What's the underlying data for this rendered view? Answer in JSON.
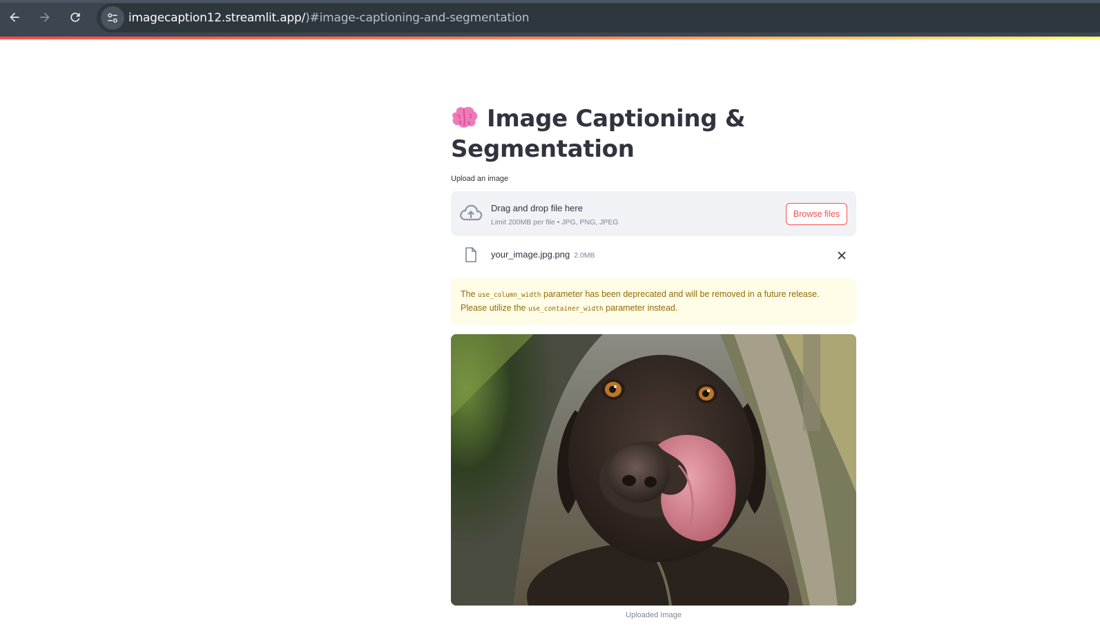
{
  "browser": {
    "url_host": "imagecaption12.streamlit.app/",
    "url_rest": ")#image-captioning-and-segmentation",
    "back_icon": "arrow-left-icon",
    "forward_icon": "arrow-right-icon",
    "reload_icon": "reload-icon",
    "site_info_icon": "tune-icon"
  },
  "page": {
    "title_line1": "Image Captioning &",
    "title_line2": "Segmentation",
    "title_icon": "brain-emoji-icon"
  },
  "uploader": {
    "label": "Upload an image",
    "drop_title": "Drag and drop file here",
    "drop_subtitle": "Limit 200MB per file • JPG, PNG, JPEG",
    "browse_label": "Browse files",
    "accent_color": "#ff4b4b"
  },
  "file": {
    "name": "your_image.jpg.png",
    "size": "2.0MB"
  },
  "warning": {
    "t1": "The ",
    "c1": "use_column_width",
    "t2": " parameter has been deprecated and will be removed in a future release. Please utilize the ",
    "c2": "use_container_width",
    "t3": " parameter instead."
  },
  "image": {
    "caption": "Uploaded Image",
    "subject": "brown dog licking its nose on a path"
  }
}
